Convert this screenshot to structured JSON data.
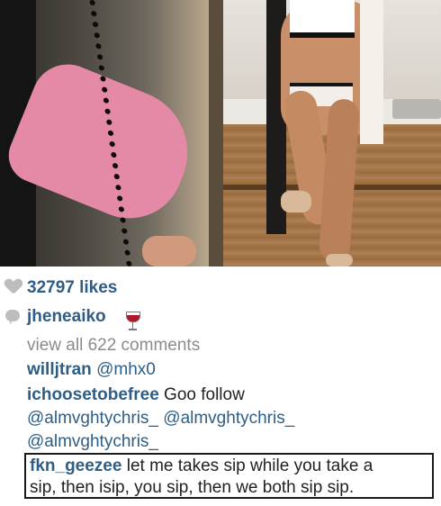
{
  "post": {
    "likes": "32797 likes",
    "owner": "jheneaiko",
    "owner_emoji": "wine-glass-icon",
    "view_all": "view all 622 comments"
  },
  "comments": [
    {
      "user": "willjtran",
      "lines": [
        "@mhx0"
      ]
    },
    {
      "user": "ichoosetobefree",
      "lines": [
        "Goo follow",
        "@almvghtychris_  @almvghtychris_",
        "@almvghtychris_"
      ]
    },
    {
      "user": "fkn_geezee",
      "lines": [
        "let me takes sip while you take a",
        "sip, then isip, you sip, then we both sip sip."
      ]
    }
  ],
  "colors": {
    "username": "#2e5e86",
    "muted": "#8b8b8b",
    "icon": "#bdbdbd",
    "text": "#222222"
  }
}
